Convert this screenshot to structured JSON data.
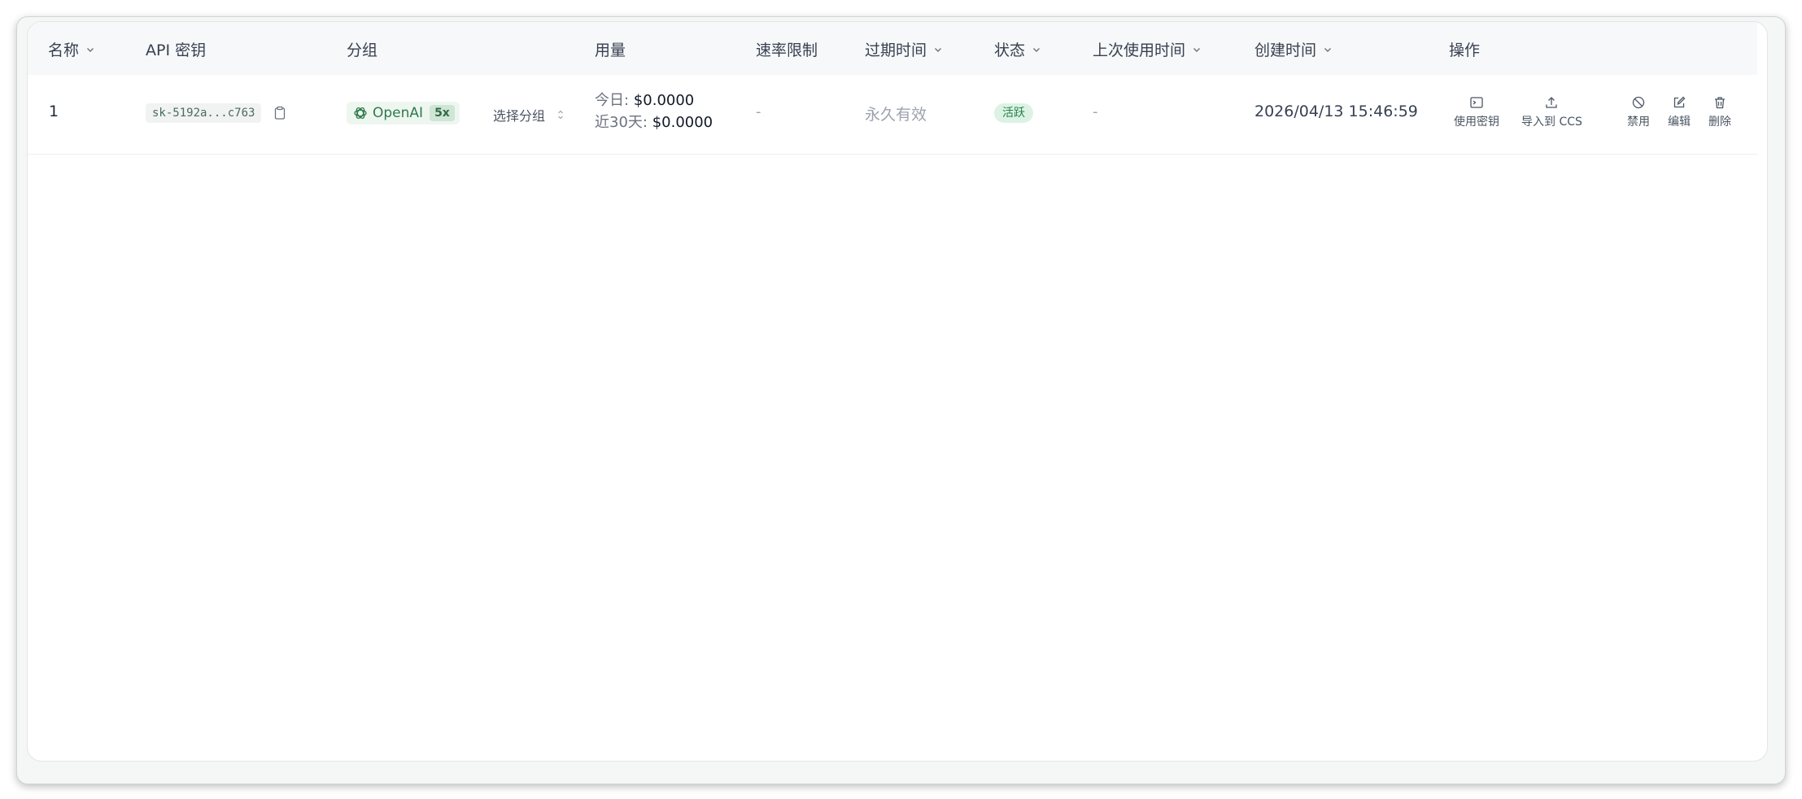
{
  "table": {
    "headers": {
      "name": "名称",
      "api_key": "API 密钥",
      "group": "分组",
      "usage": "用量",
      "rate_limit": "速率限制",
      "expires": "过期时间",
      "status": "状态",
      "last_used": "上次使用时间",
      "created": "创建时间",
      "actions": "操作"
    },
    "rows": [
      {
        "name": "1",
        "api_key": "sk-5192a...c763",
        "group_name": "OpenAI",
        "group_multiplier": "5x",
        "select_group": "选择分组",
        "usage_today_label": "今日:",
        "usage_today_value": "$0.0000",
        "usage_30d_label": "近30天:",
        "usage_30d_value": "$0.0000",
        "rate_limit": "-",
        "expires": "永久有效",
        "status": "活跃",
        "last_used": "-",
        "created": "2026/04/13 15:46:59",
        "actions": {
          "use_key": "使用密钥",
          "import_ccs": "导入到 CCS",
          "disable": "禁用",
          "edit": "编辑",
          "delete": "删除"
        }
      }
    ]
  },
  "colors": {
    "accent_green": "#2f7a4c",
    "status_bg": "#dcf3e4",
    "header_bg": "#f7f8f9"
  },
  "icons": {
    "sort": "chevron-down-icon",
    "copy": "clipboard-icon",
    "group": "openai-logo-icon",
    "select": "updown-chevron-icon",
    "use_key": "terminal-icon",
    "import": "upload-icon",
    "disable": "ban-icon",
    "edit": "edit-icon",
    "delete": "trash-icon"
  }
}
